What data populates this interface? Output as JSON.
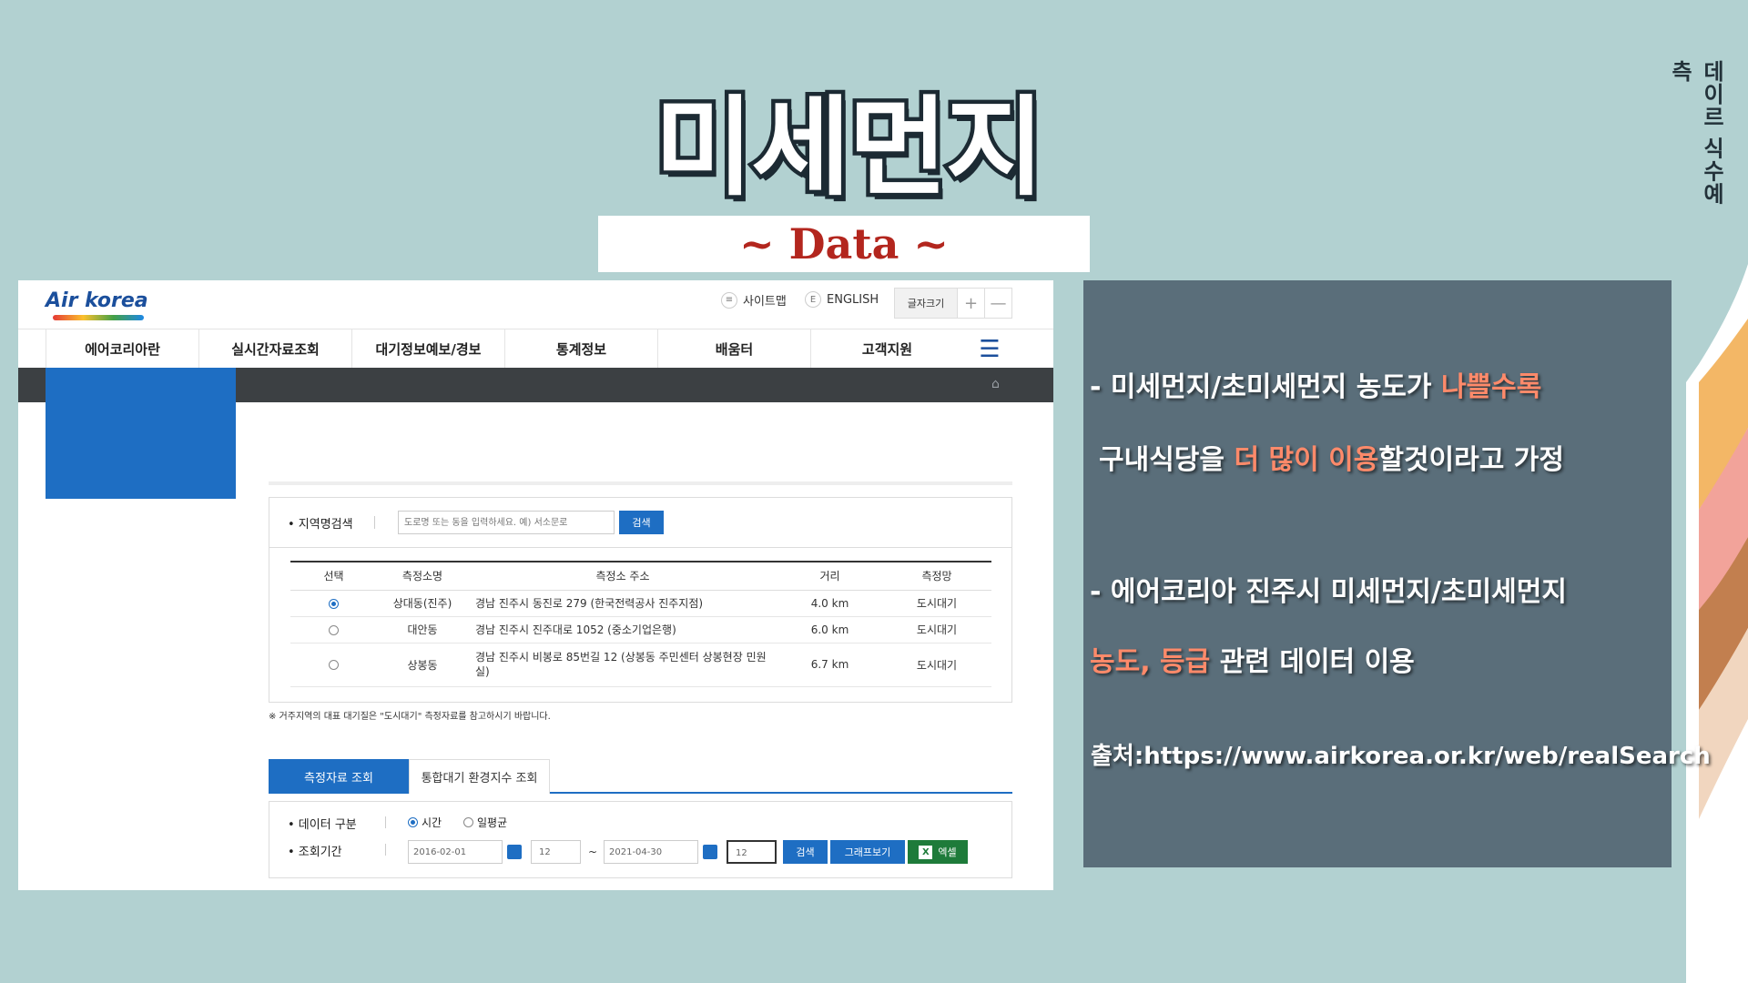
{
  "side_label": "데이르 식수예측",
  "title": "미세먼지",
  "subtitle": "~ Data ~",
  "screenshot": {
    "logo": "Air korea",
    "util": {
      "sitemap": "사이트맵",
      "english": "ENGLISH",
      "font_size": "글자크기",
      "plus": "+",
      "minus": "—",
      "sitemap_icon": "≡",
      "english_icon": "E"
    },
    "nav": [
      "에어코리아란",
      "실시간자료조회",
      "대기정보예보/경보",
      "통계정보",
      "배움터",
      "고객지원"
    ],
    "menu_icon": "☰",
    "home_icon": "⌂",
    "search": {
      "label": "• 지역명검색",
      "placeholder": "도로명 또는 동을 입력하세요. 예) 서소문로",
      "button": "검색"
    },
    "table": {
      "headers": [
        "선택",
        "측정소명",
        "측정소 주소",
        "거리",
        "측정망"
      ],
      "rows": [
        {
          "name": "상대동(진주)",
          "addr": "경남 진주시 동진로 279 (한국전력공사 진주지점)",
          "dist": "4.0 km",
          "net": "도시대기"
        },
        {
          "name": "대안동",
          "addr": "경남 진주시 진주대로 1052 (중소기업은행)",
          "dist": "6.0 km",
          "net": "도시대기"
        },
        {
          "name": "상봉동",
          "addr": "경남 진주시 비봉로 85번길 12 (상봉동 주민센터 상봉현장 민원실)",
          "dist": "6.7 km",
          "net": "도시대기"
        }
      ]
    },
    "note": "※ 거주지역의 대표 대기질은 \"도시대기\" 측정자료를 참고하시기 바랍니다.",
    "tabs": [
      "측정자료 조회",
      "통합대기 환경지수 조회"
    ],
    "form": {
      "data_type_label": "• 데이터 구분",
      "opt_hour": "시간",
      "opt_day": "일평균",
      "period_label": "• 조회기간",
      "start_date": "2016-02-01",
      "start_hour": "12",
      "tilde": "~",
      "end_date": "2021-04-30",
      "end_hour": "12",
      "btn_search": "검색",
      "btn_graph": "그래프보기",
      "btn_excel": "엑셀",
      "excel_icon": "X"
    }
  },
  "info": {
    "line1_pre": "-  미세먼지/초미세먼지 농도가 ",
    "line1_hl": "나쁠수록",
    "line2_pre": "구내식당을 ",
    "line2_hl": "더 많이 이용",
    "line2_post": "할것이라고 가정",
    "line3": "- 에어코리아 진주시 미세먼지/초미세먼지",
    "line4_hl": "농도, 등급",
    "line4_post": " 관련 데이터 이용",
    "source": "출처:https://www.airkorea.or.kr/web/realSearch"
  },
  "colors": {
    "background": "#b2d1d1",
    "panel": "#5a6e7a",
    "highlight": "#ff8a6a",
    "subtitle": "#b3261e",
    "primary_blue": "#1e6ec3",
    "excel_green": "#1e7b3a"
  }
}
